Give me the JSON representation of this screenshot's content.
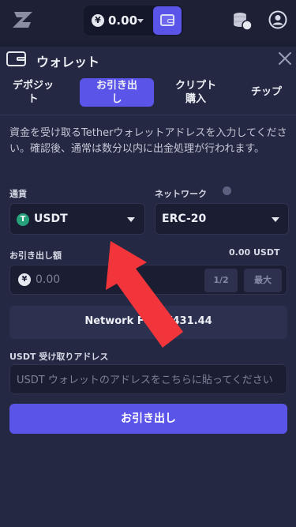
{
  "header": {
    "logo_icon": "z-logo-icon",
    "balance": {
      "currency_symbol": "¥",
      "amount": "0.00"
    },
    "wallet_icon": "wallet-icon",
    "coins_icon": "coins-stack-icon",
    "profile_icon": "user-circle-icon"
  },
  "panel": {
    "title": "ウォレット",
    "tabs": [
      {
        "line1": "デポジッ",
        "line2": "ト",
        "active": false
      },
      {
        "line1": "お引き出",
        "line2": "し",
        "active": true
      },
      {
        "line1": "クリプト",
        "line2": "購入",
        "active": false
      },
      {
        "line1": "チップ",
        "line2": "",
        "active": false
      }
    ],
    "description": "資金を受け取るTetherウォレットアドレスを入力してください。確認後、通常は数分以内に出金処理が行われます。",
    "currency": {
      "label": "通貨",
      "value": "USDT"
    },
    "network": {
      "label": "ネットワーク",
      "value": "ERC-20"
    },
    "amount": {
      "label": "お引き出し額",
      "available": "0.00 USDT",
      "currency_symbol": "¥",
      "placeholder": "0.00",
      "half_label": "1/2",
      "max_label": "最大"
    },
    "fee_text": "Network Fee: ¥431.44",
    "address": {
      "label": "USDT 受け取りアドレス",
      "placeholder": "USDT ウォレットのアドレスをこちらに貼ってください"
    },
    "submit_label": "お引き出し"
  },
  "colors": {
    "background": "#1b1f34",
    "panel": "#242842",
    "accent": "#5b54e8",
    "tether": "#26a17b",
    "arrow": "#f2353a"
  }
}
